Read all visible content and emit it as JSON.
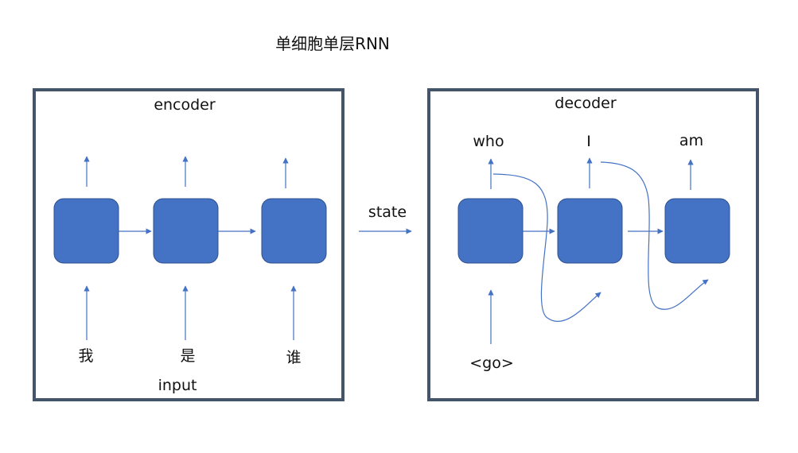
{
  "title": "单细胞单层RNN",
  "encoder": {
    "label": "encoder",
    "inputs": [
      "我",
      "是",
      "谁"
    ],
    "input_label": "input"
  },
  "state_label": "state",
  "decoder": {
    "label": "decoder",
    "outputs": [
      "who",
      "I",
      "am"
    ],
    "go_label": "<go>"
  },
  "colors": {
    "cell_fill": "#4472c4",
    "cell_stroke": "#2f528f",
    "frame": "#44546a",
    "arrow": "#4472c4"
  }
}
